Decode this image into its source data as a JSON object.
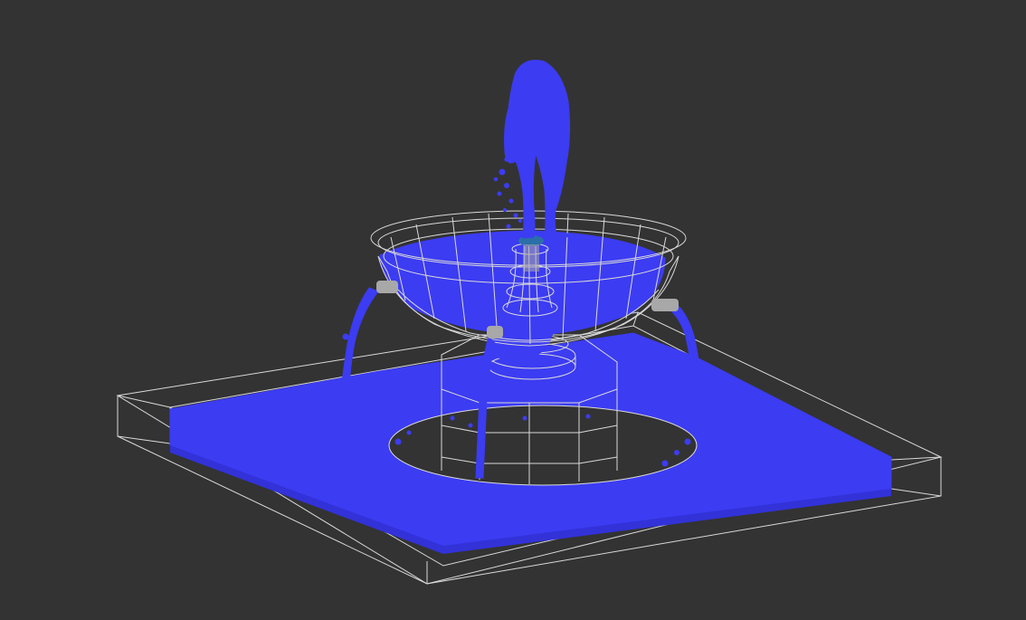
{
  "viewport": {
    "background": "#333333",
    "wire_color": "#d9d9d9",
    "fluid_color": "#3c3cf2",
    "fluid_highlight": "#4a4af8",
    "nozzle_color": "#a8a8a8"
  },
  "objects": [
    {
      "name": "basin-frame",
      "kind": "wireframe"
    },
    {
      "name": "basin-water",
      "kind": "fluid"
    },
    {
      "name": "upper-bowl",
      "kind": "wireframe"
    },
    {
      "name": "bowl-water",
      "kind": "fluid"
    },
    {
      "name": "pedestal",
      "kind": "wireframe"
    },
    {
      "name": "fountain-jet",
      "kind": "fluid"
    },
    {
      "name": "spout-left",
      "kind": "nozzle"
    },
    {
      "name": "spout-right",
      "kind": "nozzle"
    },
    {
      "name": "spout-front",
      "kind": "nozzle"
    }
  ]
}
